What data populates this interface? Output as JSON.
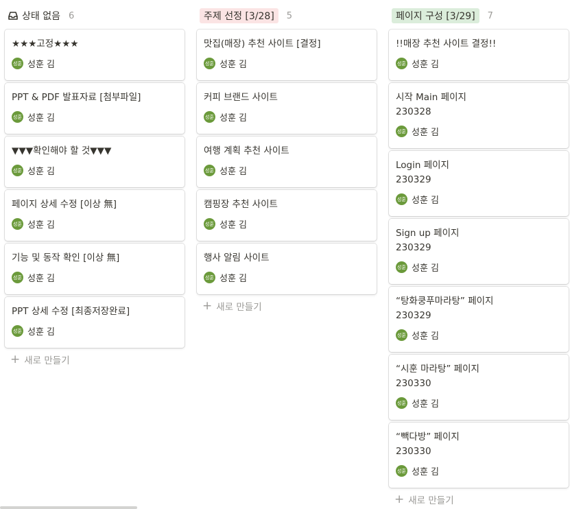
{
  "columns": [
    {
      "title": "상태 없음",
      "count": "6",
      "cards": [
        {
          "title": "★★★고정★★★"
        },
        {
          "title": "PPT & PDF 발표자료 [첨부파일]"
        },
        {
          "title": "▼▼▼확인해야 할 것▼▼▼"
        },
        {
          "title": "페이지 상세 수정 [이상 無]"
        },
        {
          "title": "기능 및 동작 확인 [이상 無]"
        },
        {
          "title": "PPT 상세 수정 [최종저장완료]"
        }
      ]
    },
    {
      "title": "주제 선정 [3/28]",
      "count": "5",
      "cards": [
        {
          "title": "맛집(매장) 추천 사이트 [결정]"
        },
        {
          "title": "커피 브랜드 사이트"
        },
        {
          "title": "여행 계획 추천 사이트"
        },
        {
          "title": "캠핑장 추천 사이트"
        },
        {
          "title": "행사 알림 사이트"
        }
      ]
    },
    {
      "title": "페이지 구성 [3/29]",
      "count": "7",
      "cards": [
        {
          "title": "!!매장 추천 사이트 결정!!"
        },
        {
          "title": "시작 Main 페이지",
          "date": "230328"
        },
        {
          "title": "Login 페이지",
          "date": "230329"
        },
        {
          "title": "Sign up 페이지",
          "date": "230329"
        },
        {
          "title": "“탕화쿵푸마라탕” 페이지",
          "date": "230329"
        },
        {
          "title": "“시훈 마라탕” 페이지",
          "date": "230330"
        },
        {
          "title": "“빽다방” 페이지",
          "date": "230330"
        }
      ]
    }
  ],
  "person": {
    "name": "성훈 김",
    "initials": "성훈",
    "avatar_color": "#6b9a3b"
  },
  "new_label": "새로 만들기",
  "icons": {
    "inbox": "inbox-icon",
    "plus": "plus-icon"
  }
}
